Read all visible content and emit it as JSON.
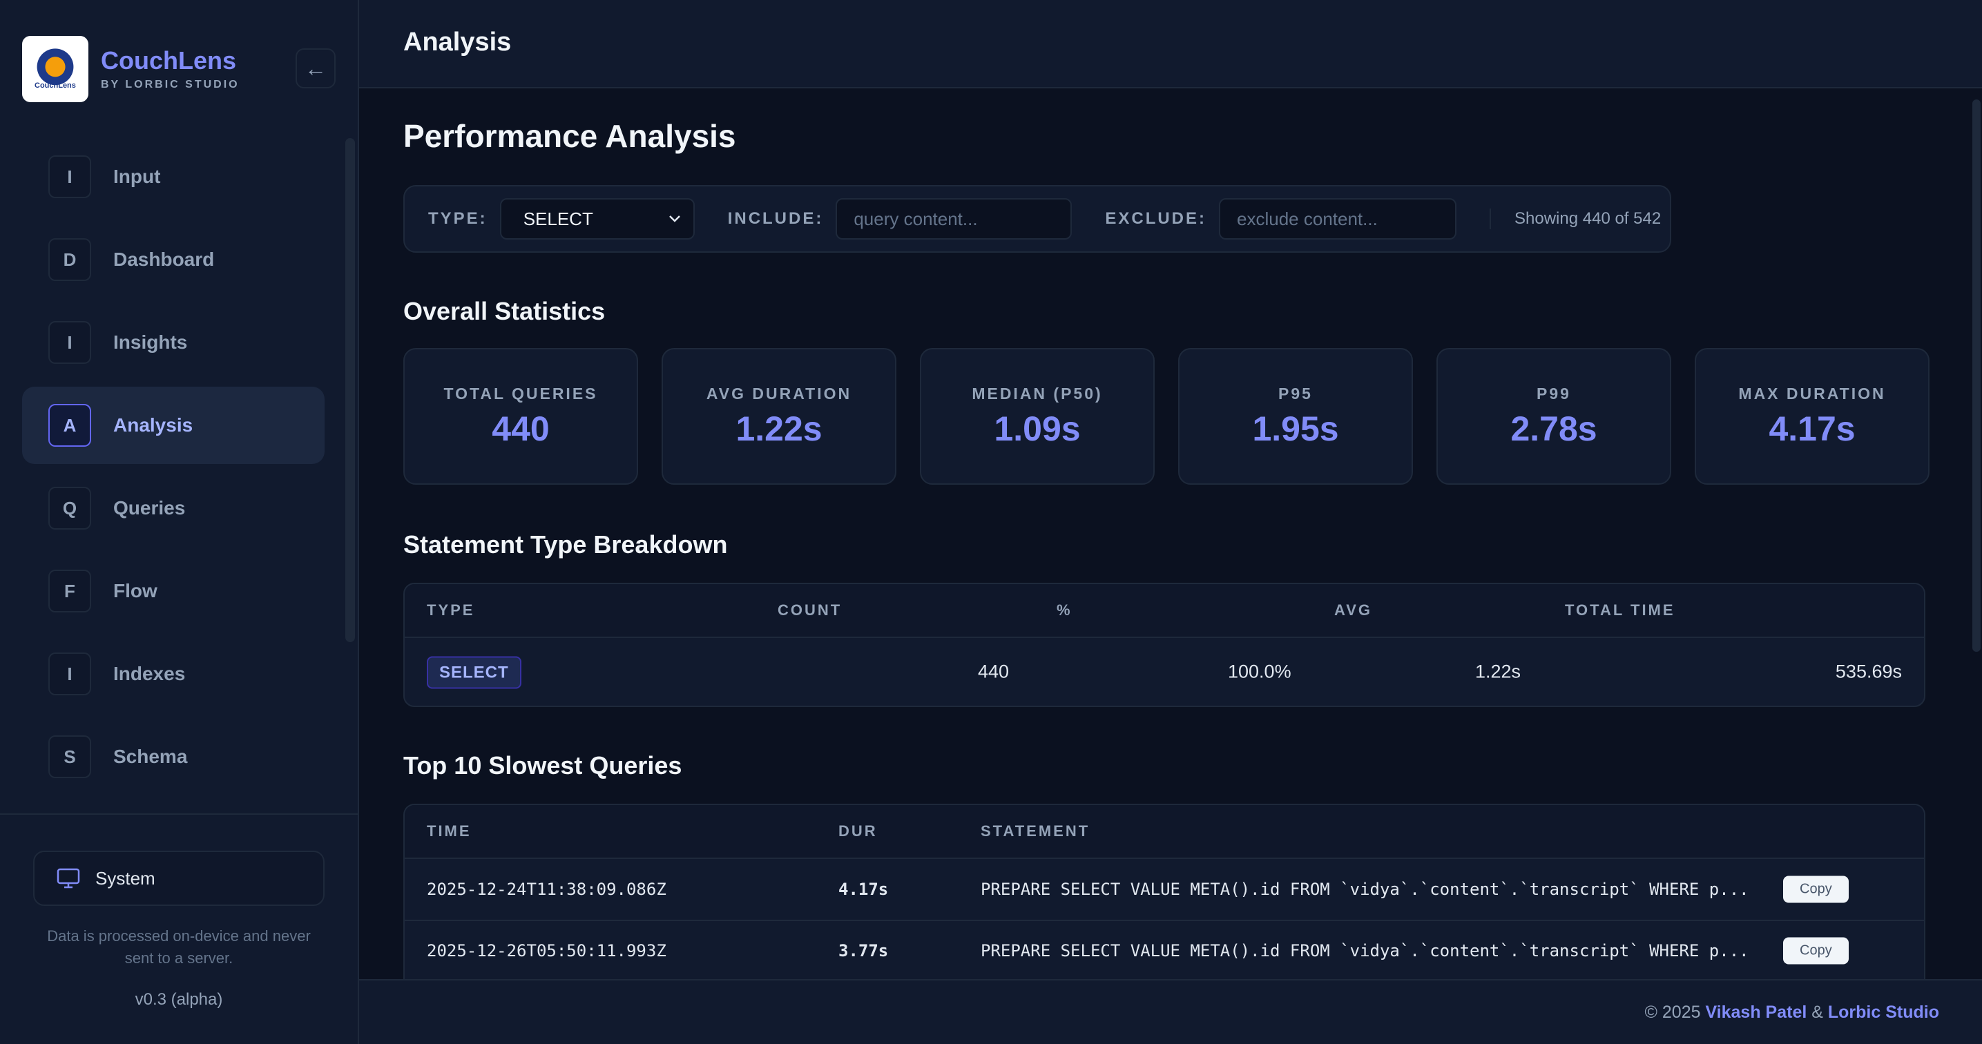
{
  "brand": {
    "name": "CouchLens",
    "sub": "BY LORBIC STUDIO",
    "logo_text": "CouchLens"
  },
  "collapse_icon": "arrow-left-icon",
  "nav": [
    {
      "letter": "I",
      "label": "Input",
      "active": false
    },
    {
      "letter": "D",
      "label": "Dashboard",
      "active": false
    },
    {
      "letter": "I",
      "label": "Insights",
      "active": false
    },
    {
      "letter": "A",
      "label": "Analysis",
      "active": true
    },
    {
      "letter": "Q",
      "label": "Queries",
      "active": false
    },
    {
      "letter": "F",
      "label": "Flow",
      "active": false
    },
    {
      "letter": "I",
      "label": "Indexes",
      "active": false
    },
    {
      "letter": "S",
      "label": "Schema",
      "active": false
    }
  ],
  "sidebar_footer": {
    "system_label": "System",
    "system_icon": "monitor-icon",
    "privacy_note": "Data is processed on-device and never sent to a server.",
    "version": "v0.3 (alpha)"
  },
  "topbar": {
    "title": "Analysis"
  },
  "page": {
    "title": "Performance Analysis"
  },
  "filters": {
    "type_label": "TYPE:",
    "type_value": "SELECT",
    "include_label": "INCLUDE:",
    "include_placeholder": "query content...",
    "exclude_label": "EXCLUDE:",
    "exclude_placeholder": "exclude content...",
    "showing": "Showing 440 of 542"
  },
  "overall": {
    "title": "Overall Statistics",
    "cards": [
      {
        "label": "TOTAL QUERIES",
        "value": "440"
      },
      {
        "label": "AVG DURATION",
        "value": "1.22s"
      },
      {
        "label": "MEDIAN (P50)",
        "value": "1.09s"
      },
      {
        "label": "P95",
        "value": "1.95s"
      },
      {
        "label": "P99",
        "value": "2.78s"
      },
      {
        "label": "MAX DURATION",
        "value": "4.17s"
      }
    ]
  },
  "breakdown": {
    "title": "Statement Type Breakdown",
    "headers": {
      "type": "TYPE",
      "count": "COUNT",
      "pct": "%",
      "avg": "AVG",
      "total": "TOTAL TIME"
    },
    "rows": [
      {
        "type": "SELECT",
        "count": "440",
        "pct": "100.0%",
        "avg": "1.22s",
        "total": "535.69s"
      }
    ]
  },
  "slowest": {
    "title": "Top 10 Slowest Queries",
    "headers": {
      "time": "TIME",
      "dur": "DUR",
      "statement": "STATEMENT"
    },
    "copy_label": "Copy",
    "rows": [
      {
        "time": "2025-12-24T11:38:09.086Z",
        "dur": "4.17s",
        "statement": "PREPARE SELECT VALUE META().id FROM `vidya`.`content`.`transcript` WHERE p..."
      },
      {
        "time": "2025-12-26T05:50:11.993Z",
        "dur": "3.77s",
        "statement": "PREPARE SELECT VALUE META().id FROM `vidya`.`content`.`transcript` WHERE p..."
      }
    ]
  },
  "footer": {
    "prefix": "© 2025 ",
    "author": "Vikash Patel",
    "amp": " & ",
    "studio": "Lorbic Studio"
  },
  "colors": {
    "accent": "#818cf8",
    "background": "#0b1120",
    "panel": "#111a2e",
    "border": "#1e293b"
  }
}
